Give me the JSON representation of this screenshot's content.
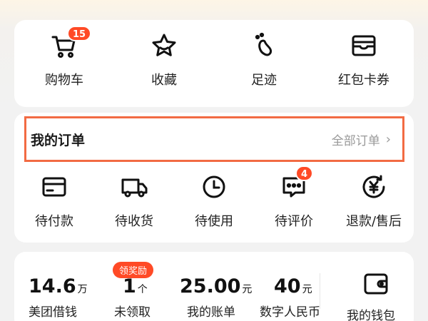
{
  "shortcuts": {
    "cart": {
      "label": "购物车",
      "badge": "15",
      "icon": "cart-icon"
    },
    "favorites": {
      "label": "收藏",
      "icon": "star-icon"
    },
    "footprints": {
      "label": "足迹",
      "icon": "footprint-icon"
    },
    "coupons": {
      "label": "红包卡券",
      "icon": "wallet-card-icon"
    }
  },
  "orders": {
    "title": "我的订单",
    "all_label": "全部订单",
    "items": [
      {
        "label": "待付款",
        "icon": "card-icon"
      },
      {
        "label": "待收货",
        "icon": "truck-icon"
      },
      {
        "label": "待使用",
        "icon": "clock-icon"
      },
      {
        "label": "待评价",
        "icon": "comment-icon",
        "badge": "4"
      },
      {
        "label": "退款/售后",
        "icon": "refund-icon"
      }
    ]
  },
  "finance": {
    "reward_tag": "领奖励",
    "items": [
      {
        "value": "14.6",
        "unit": "万",
        "label": "美团借钱"
      },
      {
        "value": "1",
        "unit": "个",
        "label": "未领取"
      },
      {
        "value": "25.00",
        "unit": "元",
        "label": "我的账单"
      },
      {
        "value": "40",
        "unit": "元",
        "label": "数字人民币"
      }
    ],
    "wallet": {
      "label": "我的钱包",
      "icon": "wallet-icon"
    }
  },
  "colors": {
    "accent": "#ff4a26",
    "highlight_border": "#f26b43",
    "muted": "#999999"
  }
}
